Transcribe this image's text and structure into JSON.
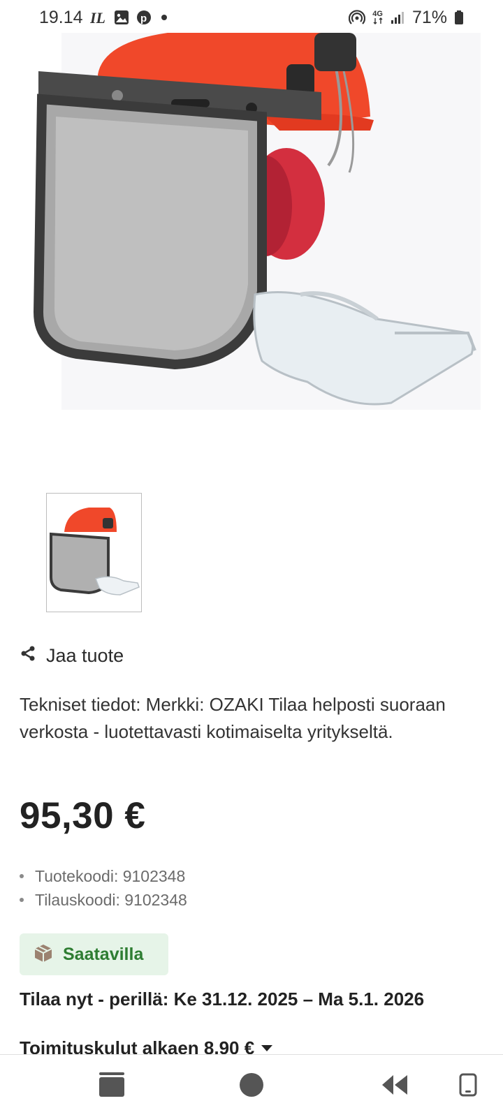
{
  "status_bar": {
    "time": "19.14",
    "network": "4G",
    "battery": "71%"
  },
  "product": {
    "image_alt": "Product image: forestry helmet with mesh visor, ear protectors and safety glasses",
    "thumbnail_alt": "Product thumbnail",
    "share_label": "Jaa tuote",
    "description": "Tekniset tiedot: Merkki: OZAKI Tilaa helposti suoraan verkosta - luotettavasti kotimaiselta yritykseltä.",
    "price": "95,30 €",
    "codes": [
      "Tuotekoodi: 9102348",
      "Tilauskoodi: 9102348"
    ],
    "availability": "Saatavilla",
    "delivery": "Tilaa nyt - perillä: Ke 31.12. 2025 – Ma 5.1. 2026",
    "shipping": "Toimituskulut alkaen 8,90 €"
  },
  "colors": {
    "availability_bg": "#e6f4e8",
    "availability_text": "#2e7d32",
    "helmet": "#f0482a"
  },
  "navbar": {
    "icons": [
      "recents-icon",
      "home-icon",
      "back-icon",
      "rotate-icon"
    ]
  }
}
